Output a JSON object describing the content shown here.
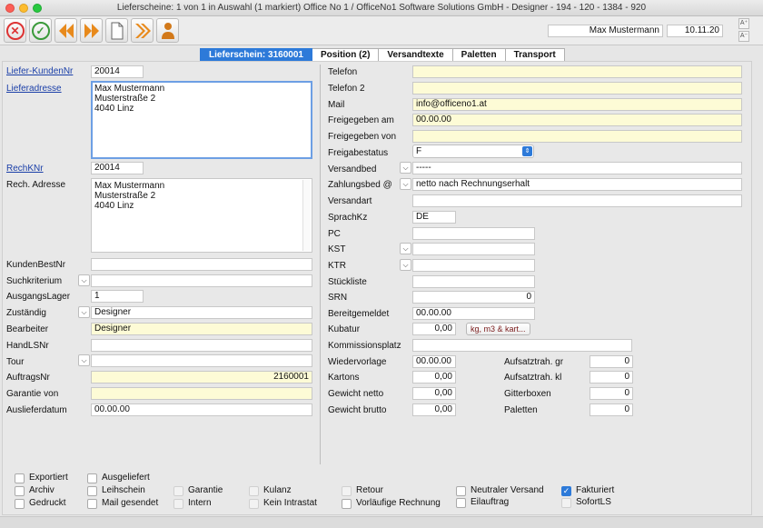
{
  "window": {
    "title": "Lieferscheine: 1 von 1 in Auswahl  (1 markiert) Office No 1 /  OfficeNo1 Software Solutions GmbH - Designer - 194 - 120 - 1384 - 920"
  },
  "header": {
    "user": "Max Mustermann",
    "date": "10.11.20"
  },
  "tabs": [
    "Lieferschein: 3160001",
    "Position (2)",
    "Versandtexte",
    "Paletten",
    "Transport"
  ],
  "left": {
    "liefer_kundennr_label": "Liefer-KundenNr",
    "liefer_kundennr": "20014",
    "lieferadresse_label": "Lieferadresse",
    "lieferadresse": [
      "Max Mustermann",
      "Musterstraße 2",
      "4040 Linz"
    ],
    "rechknr_label": "RechKNr",
    "rechknr": "20014",
    "rech_adresse_label": "Rech. Adresse",
    "rech_adresse": [
      "Max Mustermann",
      "Musterstraße 2",
      "4040 Linz"
    ],
    "kundenbestnr_label": "KundenBestNr",
    "kundenbestnr": "",
    "suchkriterium_label": "Suchkriterium",
    "suchkriterium": "",
    "ausgangslager_label": "AusgangsLager",
    "ausgangslager": "1",
    "zustaendig_label": "Zuständig",
    "zustaendig": "Designer",
    "bearbeiter_label": "Bearbeiter",
    "bearbeiter": "Designer",
    "handlsnr_label": "HandLSNr",
    "handlsnr": "",
    "tour_label": "Tour",
    "tour": "",
    "auftragsnr_label": "AuftragsNr",
    "auftragsnr": "2160001",
    "garantie_von_label": "Garantie von",
    "garantie_von": "",
    "auslieferdatum_label": "Auslieferdatum",
    "auslieferdatum": "00.00.00"
  },
  "right": {
    "telefon_label": "Telefon",
    "telefon": "",
    "telefon2_label": "Telefon 2",
    "telefon2": "",
    "mail_label": "Mail",
    "mail": "info@officeno1.at",
    "freigegeben_am_label": "Freigegeben am",
    "freigegeben_am": "00.00.00",
    "freigegeben_von_label": "Freigegeben von",
    "freigegeben_von": "",
    "freigabestatus_label": "Freigabestatus",
    "freigabestatus": "F",
    "versandbed_label": "Versandbed",
    "versandbed": "-----",
    "zahlungsbed_label": "Zahlungsbed @",
    "zahlungsbed": "netto nach Rechnungserhalt",
    "versandart_label": "Versandart",
    "versandart": "",
    "sprachkz_label": "SprachKz",
    "sprachkz": "DE",
    "pc_label": "PC",
    "pc": "",
    "kst_label": "KST",
    "kst": "",
    "ktr_label": "KTR",
    "ktr": "",
    "stueckliste_label": "Stückliste",
    "stueckliste": "",
    "srn_label": "SRN",
    "srn": "0",
    "bereitgemeldet_label": "Bereitgemeldet",
    "bereitgemeldet": "00.00.00",
    "kubatur_label": "Kubatur",
    "kubatur": "0,00",
    "kubatur_button": "kg, m3 & kart...",
    "kommissionsplatz_label": "Kommissionsplatz",
    "kommissionsplatz": "",
    "wiedervorlage_label": "Wiedervorlage",
    "wiedervorlage": "00.00.00",
    "kartons_label": "Kartons",
    "kartons": "0,00",
    "gewicht_netto_label": "Gewicht netto",
    "gewicht_netto": "0,00",
    "gewicht_brutto_label": "Gewicht brutto",
    "gewicht_brutto": "0,00",
    "aufsatz_gr_label": "Aufsatztrah. gr",
    "aufsatz_gr": "0",
    "aufsatz_kl_label": "Aufsatztrah. kl",
    "aufsatz_kl": "0",
    "gitterboxen_label": "Gitterboxen",
    "gitterboxen": "0",
    "paletten_label": "Paletten",
    "paletten": "0"
  },
  "checkboxes": {
    "exportiert": "Exportiert",
    "archiv": "Archiv",
    "gedruckt": "Gedruckt",
    "ausgeliefert": "Ausgeliefert",
    "leihschein": "Leihschein",
    "mail_gesendet": "Mail gesendet",
    "garantie": "Garantie",
    "intern": "Intern",
    "kulanz": "Kulanz",
    "kein_intrastat": "Kein Intrastat",
    "retour": "Retour",
    "vorlaeufige_rechnung": "Vorläufige Rechnung",
    "neutraler_versand": "Neutraler Versand",
    "eilauftrag": "Eilauftrag",
    "fakturiert": "Fakturiert",
    "sofortls": "SofortLS"
  },
  "colors": {
    "accent": "#2d7ad9",
    "highlight_field": "#fdfbd6",
    "link": "#1a3fa8"
  }
}
